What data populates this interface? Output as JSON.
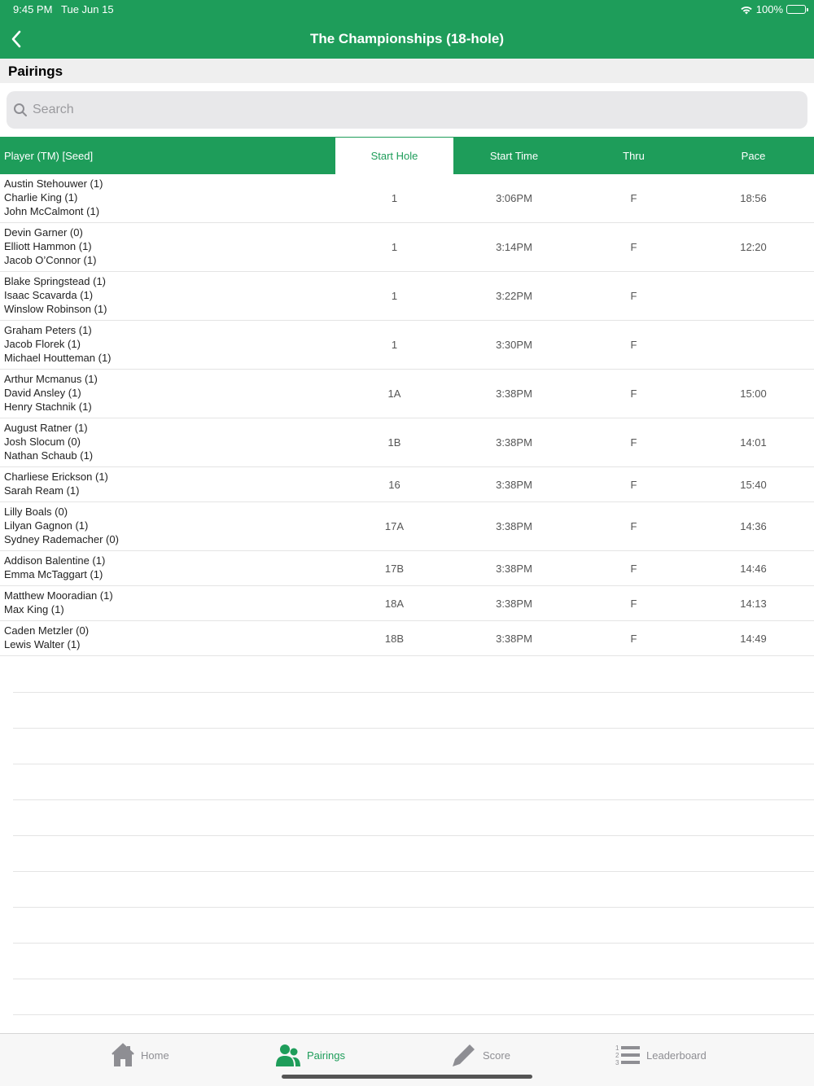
{
  "status_bar": {
    "time": "9:45 PM",
    "date": "Tue Jun 15",
    "battery": "100%"
  },
  "header": {
    "title": "The Championships (18-hole)"
  },
  "section": {
    "title": "Pairings"
  },
  "search": {
    "placeholder": "Search"
  },
  "table": {
    "columns": [
      "Player (TM) [Seed]",
      "Start Hole",
      "Start Time",
      "Thru",
      "Pace"
    ],
    "active_column": "Start Hole",
    "rows": [
      {
        "players": [
          "Austin Stehouwer (1)",
          "Charlie King (1)",
          "John McCalmont (1)"
        ],
        "start_hole": "1",
        "start_time": "3:06PM",
        "thru": "F",
        "pace": "18:56"
      },
      {
        "players": [
          "Devin Garner (0)",
          "Elliott Hammon (1)",
          "Jacob O’Connor (1)"
        ],
        "start_hole": "1",
        "start_time": "3:14PM",
        "thru": "F",
        "pace": "12:20"
      },
      {
        "players": [
          "Blake Springstead (1)",
          "Isaac Scavarda (1)",
          "Winslow Robinson (1)"
        ],
        "start_hole": "1",
        "start_time": "3:22PM",
        "thru": "F",
        "pace": ""
      },
      {
        "players": [
          "Graham Peters (1)",
          "Jacob Florek (1)",
          "Michael Houtteman (1)"
        ],
        "start_hole": "1",
        "start_time": "3:30PM",
        "thru": "F",
        "pace": ""
      },
      {
        "players": [
          "Arthur Mcmanus (1)",
          "David Ansley (1)",
          "Henry Stachnik (1)"
        ],
        "start_hole": "1A",
        "start_time": "3:38PM",
        "thru": "F",
        "pace": "15:00"
      },
      {
        "players": [
          "August Ratner (1)",
          "Josh Slocum (0)",
          "Nathan Schaub (1)"
        ],
        "start_hole": "1B",
        "start_time": "3:38PM",
        "thru": "F",
        "pace": "14:01"
      },
      {
        "players": [
          "Charliese Erickson (1)",
          "Sarah Ream (1)"
        ],
        "start_hole": "16",
        "start_time": "3:38PM",
        "thru": "F",
        "pace": "15:40"
      },
      {
        "players": [
          "Lilly Boals (0)",
          "Lilyan Gagnon (1)",
          "Sydney Rademacher (0)"
        ],
        "start_hole": "17A",
        "start_time": "3:38PM",
        "thru": "F",
        "pace": "14:36"
      },
      {
        "players": [
          "Addison Balentine (1)",
          "Emma McTaggart (1)"
        ],
        "start_hole": "17B",
        "start_time": "3:38PM",
        "thru": "F",
        "pace": "14:46"
      },
      {
        "players": [
          "Matthew Mooradian (1)",
          "Max King (1)"
        ],
        "start_hole": "18A",
        "start_time": "3:38PM",
        "thru": "F",
        "pace": "14:13"
      },
      {
        "players": [
          "Caden Metzler (0)",
          "Lewis Walter (1)"
        ],
        "start_hole": "18B",
        "start_time": "3:38PM",
        "thru": "F",
        "pace": "14:49"
      }
    ]
  },
  "tabbar": {
    "tabs": [
      {
        "label": "Home",
        "icon": "home-icon",
        "active": false
      },
      {
        "label": "Pairings",
        "icon": "people-icon",
        "active": true
      },
      {
        "label": "Score",
        "icon": "pencil-icon",
        "active": false
      },
      {
        "label": "Leaderboard",
        "icon": "list-icon",
        "active": false
      }
    ]
  },
  "colors": {
    "accent": "#1e9d5a",
    "tab_inactive": "#8e8e93",
    "section_bg": "#efefef"
  }
}
